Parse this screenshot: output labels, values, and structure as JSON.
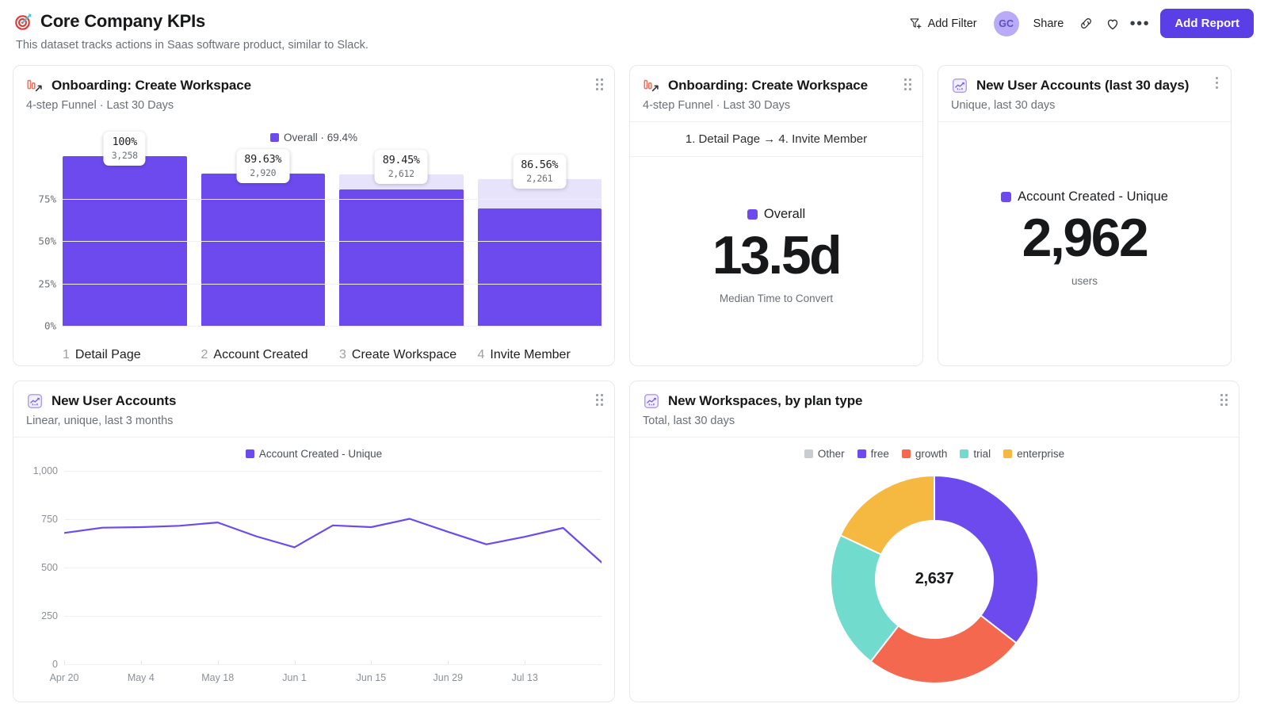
{
  "header": {
    "icon": "target-icon",
    "title": "Core Company KPIs",
    "subtitle": "This dataset tracks actions in Saas software product, similar to Slack.",
    "actions": {
      "add_filter": "Add Filter",
      "avatar_initials": "GC",
      "share": "Share",
      "link_icon": "link-icon",
      "favorite_icon": "heart-icon",
      "more_icon": "ellipsis-icon",
      "add_report": "Add Report"
    }
  },
  "cards": {
    "funnel_chart": {
      "icon": "funnel-chart-icon",
      "title": "Onboarding: Create Workspace",
      "subtitle": "4-step Funnel · Last 30 Days",
      "handle": "drag-handle-icon"
    },
    "funnel_metric": {
      "icon": "funnel-chart-icon",
      "title": "Onboarding: Create Workspace",
      "subtitle": "4-step Funnel · Last 30 Days",
      "step_range": "1. Detail Page → 4. Invite Member",
      "legend_label": "Overall",
      "value": "13.5d",
      "footer": "Median Time to Convert",
      "handle": "drag-handle-icon"
    },
    "accounts_metric": {
      "icon": "line-chart-icon",
      "title": "New User Accounts (last 30 days)",
      "subtitle": "Unique, last 30 days",
      "legend_label": "Account Created - Unique",
      "value": "2,962",
      "footer": "users",
      "handle": "kebab-icon"
    },
    "accounts_line": {
      "icon": "line-chart-icon",
      "title": "New User Accounts",
      "subtitle": "Linear, unique, last 3 months",
      "handle": "drag-handle-icon"
    },
    "workspaces_donut": {
      "icon": "line-chart-icon",
      "title": "New Workspaces, by plan type",
      "subtitle": "Total, last 30 days",
      "handle": "drag-handle-icon"
    }
  },
  "colors": {
    "accent_purple": "#6d4aee",
    "brand_button": "#5b3fe6",
    "ghost_bar": "#e7e3fb",
    "other_grey": "#c9ccd1",
    "free_purple": "#6d4aee",
    "growth_red": "#f4684f",
    "trial_teal": "#71dcce",
    "enterprise_yellow": "#f5b841",
    "funnel_icon_red": "#f4715c"
  },
  "chart_data": [
    {
      "id": "onboarding-funnel",
      "type": "bar",
      "title": "Onboarding: Create Workspace",
      "subtitle": "4-step Funnel · Last 30 Days",
      "legend": "Overall · 69.4%",
      "overall_conversion_pct": 69.4,
      "xlabel": "",
      "ylabel": "",
      "ylim": [
        0,
        100
      ],
      "yticks": [
        "0%",
        "25%",
        "50%",
        "75%"
      ],
      "ytick_values": [
        0,
        25,
        50,
        75
      ],
      "grid": true,
      "categories": [
        "Detail Page",
        "Account Created",
        "Create Workspace",
        "Invite Member"
      ],
      "step_numbers": [
        "1",
        "2",
        "3",
        "4"
      ],
      "values": [
        100,
        89.63,
        89.45,
        86.56
      ],
      "pct_labels": [
        "100%",
        "89.63%",
        "89.45%",
        "86.56%"
      ],
      "counts": [
        "3,258",
        "2,920",
        "2,612",
        "2,261"
      ],
      "count_values": [
        3258,
        2920,
        2612,
        2261
      ],
      "bar_fill_pct": [
        100,
        89.63,
        80.18,
        69.39
      ]
    },
    {
      "id": "median-time-to-convert",
      "type": "table",
      "title": "Onboarding: Create Workspace",
      "subtitle": "4-step Funnel · Last 30 Days",
      "annotation": "1. Detail Page → 4. Invite Member",
      "series_name": "Overall",
      "value": "13.5d",
      "value_numeric": 13.5,
      "unit": "d",
      "caption": "Median Time to Convert"
    },
    {
      "id": "new-user-accounts-30d",
      "type": "table",
      "title": "New User Accounts (last 30 days)",
      "subtitle": "Unique, last 30 days",
      "series_name": "Account Created - Unique",
      "value": "2,962",
      "value_numeric": 2962,
      "caption": "users"
    },
    {
      "id": "new-user-accounts-line",
      "type": "line",
      "title": "New User Accounts",
      "subtitle": "Linear, unique, last 3 months",
      "legend": [
        "Account Created - Unique"
      ],
      "legend_position": "top-center",
      "xlabel": "",
      "ylabel": "",
      "ylim": [
        0,
        1000
      ],
      "yticks": [
        "0",
        "250",
        "500",
        "750",
        "1,000"
      ],
      "ytick_values": [
        0,
        250,
        500,
        750,
        1000
      ],
      "grid": true,
      "xticks": [
        "Apr 20",
        "May 4",
        "May 18",
        "Jun 1",
        "Jun 15",
        "Jun 29",
        "Jul 13"
      ],
      "x": [
        0,
        1,
        2,
        3,
        4,
        5,
        6,
        7,
        8,
        9,
        10,
        11,
        12,
        13,
        14
      ],
      "series": [
        {
          "name": "Account Created - Unique",
          "color": "#6d4aee",
          "values": [
            679,
            706,
            709,
            716,
            733,
            662,
            605,
            718,
            709,
            752,
            685,
            620,
            659,
            705,
            527
          ]
        }
      ]
    },
    {
      "id": "new-workspaces-by-plan",
      "type": "pie",
      "title": "New Workspaces, by plan type",
      "subtitle": "Total, last 30 days",
      "center_label": "2,637",
      "center_value": 2637,
      "legend_position": "top-center",
      "labels": [
        "Other",
        "free",
        "growth",
        "trial",
        "enterprise"
      ],
      "colors": [
        "#c9ccd1",
        "#6d4aee",
        "#f4684f",
        "#71dcce",
        "#f5b841"
      ],
      "values": [
        0,
        35.5,
        25.0,
        21.5,
        18.0
      ],
      "slice_percent": [
        0,
        35.5,
        25.0,
        21.5,
        18.0
      ]
    }
  ]
}
